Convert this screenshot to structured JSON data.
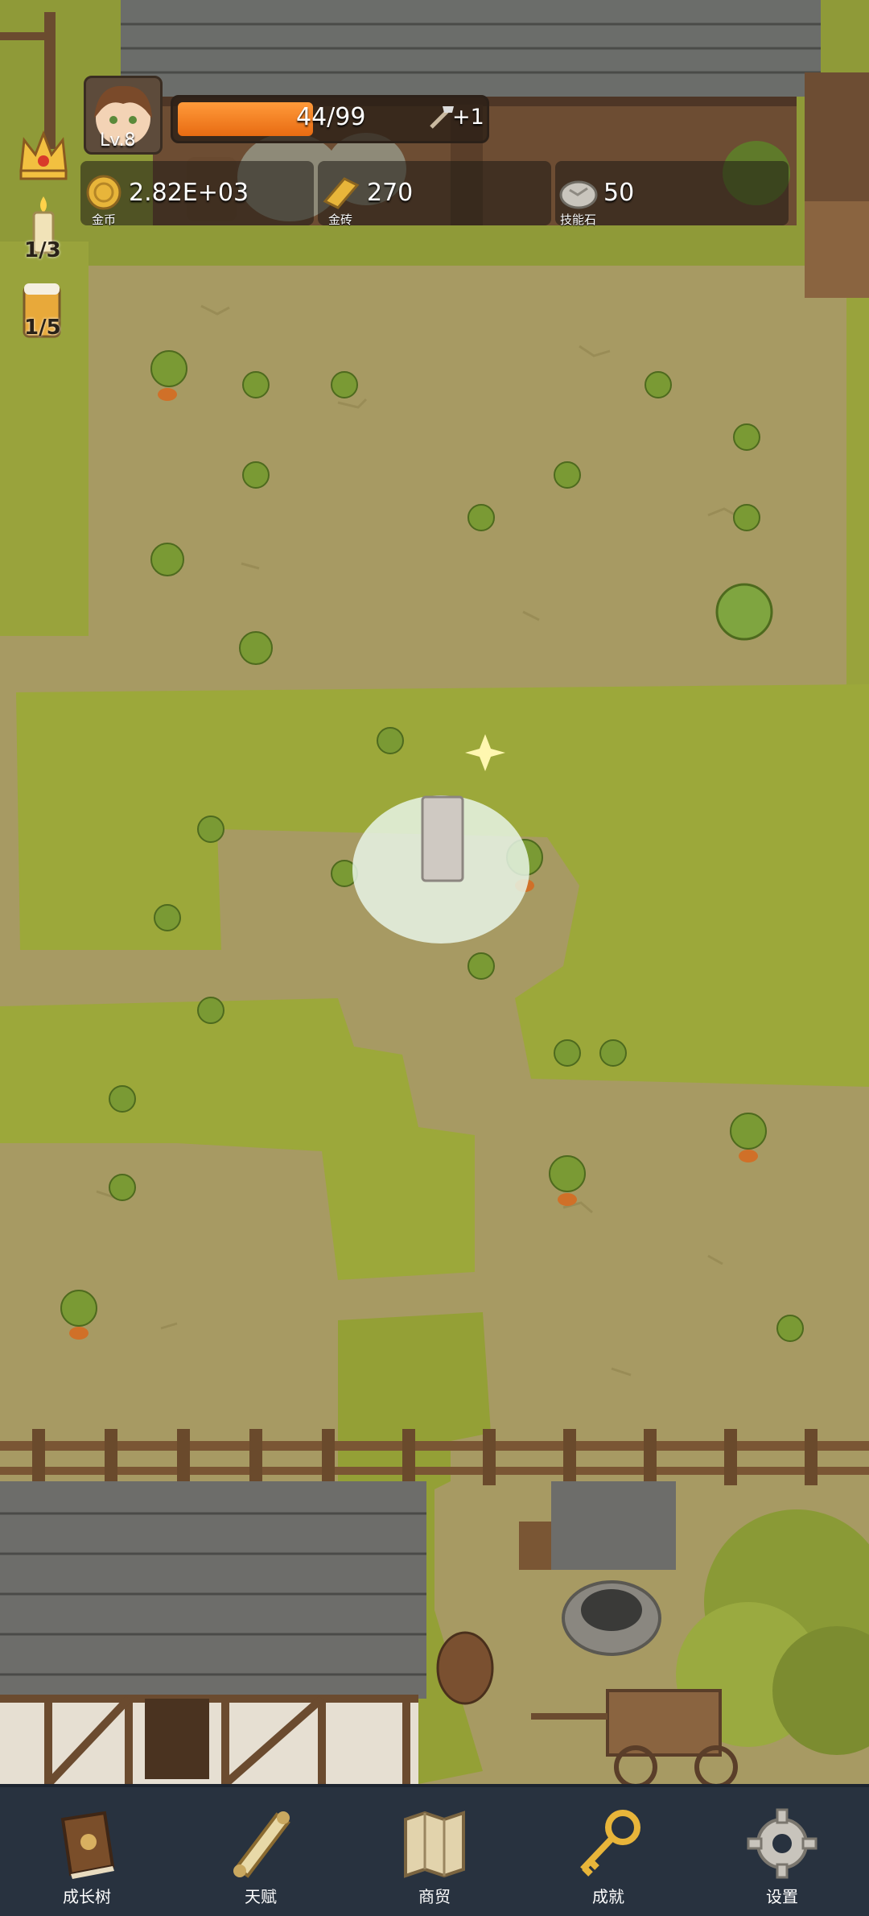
{
  "player": {
    "level_label": "Lv.8",
    "exp_text": "44/99",
    "exp_fraction": 0.444,
    "exp_bonus": "+1"
  },
  "resources": [
    {
      "value": "2.82E+03",
      "label": "金币",
      "icon": "gold-coin-icon"
    },
    {
      "value": "270",
      "label": "金砖",
      "icon": "gold-bar-icon"
    },
    {
      "value": "50",
      "label": "技能石",
      "icon": "skill-stone-icon"
    }
  ],
  "side_items": [
    {
      "icon": "crown-icon"
    },
    {
      "icon": "candle-icon",
      "count": "1/3"
    },
    {
      "icon": "beer-mug-icon",
      "count": "1/5"
    }
  ],
  "nav": [
    {
      "label": "成长树",
      "icon": "book-icon"
    },
    {
      "label": "天赋",
      "icon": "scroll-icon"
    },
    {
      "label": "商贸",
      "icon": "map-icon"
    },
    {
      "label": "成就",
      "icon": "key-icon"
    },
    {
      "label": "设置",
      "icon": "gear-icon"
    }
  ],
  "colors": {
    "grass": "#9aa23a",
    "dirt": "#a79a63",
    "exp_bar": "#f07a1e",
    "nav_bg": "#28323f"
  }
}
